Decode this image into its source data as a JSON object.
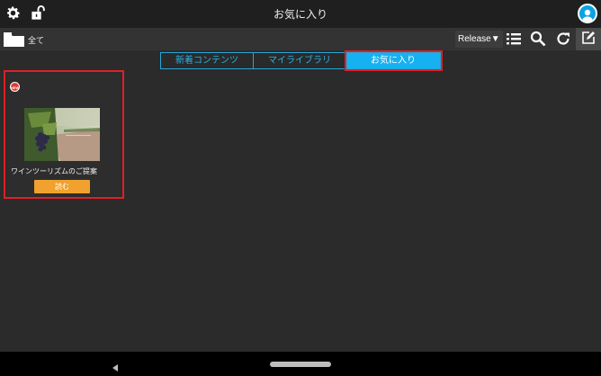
{
  "topbar": {
    "title": "お気に入り",
    "icons": [
      "gear-icon",
      "unlock-icon",
      "user-avatar-icon"
    ]
  },
  "toolbar": {
    "folder_label": "全て",
    "release_label": "Release▼",
    "icons": [
      "folder-icon",
      "list-icon",
      "search-icon",
      "refresh-icon",
      "edit-icon"
    ]
  },
  "tabs": [
    {
      "label": "新着コンテンツ",
      "active": false
    },
    {
      "label": "マイライブラリ",
      "active": false
    },
    {
      "label": "お気に入り",
      "active": true
    }
  ],
  "content": {
    "items": [
      {
        "badge": "NEW",
        "title": "ワインツーリズムのご提案",
        "read_label": "読む"
      }
    ]
  },
  "colors": {
    "accent": "#16b1f1",
    "highlight": "#e01f26",
    "button": "#f0a12e",
    "background": "#2b2b2b"
  }
}
